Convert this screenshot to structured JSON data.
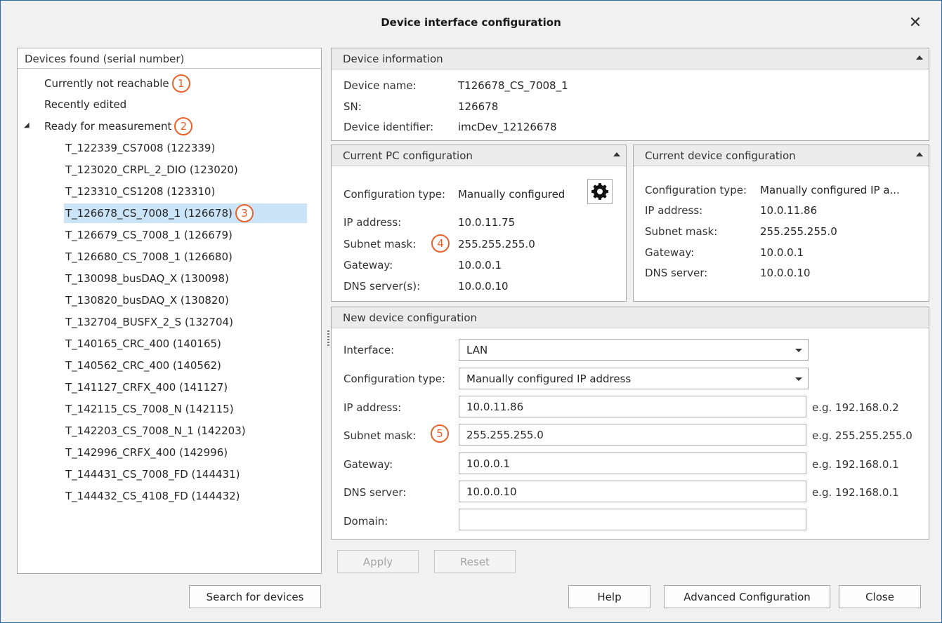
{
  "window": {
    "title": "Device interface configuration",
    "close_glyph": "✕"
  },
  "tree": {
    "header": "Devices found (serial number)",
    "categories": {
      "not_reachable": "Currently not reachable",
      "recently_edited": "Recently edited",
      "ready": "Ready for measurement"
    },
    "expander_glyph": "◢",
    "devices": [
      "T_122339_CS7008 (122339)",
      "T_123020_CRPL_2_DIO (123020)",
      "T_123310_CS1208 (123310)",
      "T_126678_CS_7008_1 (126678)",
      "T_126679_CS_7008_1 (126679)",
      "T_126680_CS_7008_1 (126680)",
      "T_130098_busDAQ_X (130098)",
      "T_130820_busDAQ_X (130820)",
      "T_132704_BUSFX_2_S (132704)",
      "T_140165_CRC_400 (140165)",
      "T_140562_CRC_400 (140562)",
      "T_141127_CRFX_400 (141127)",
      "T_142115_CS_7008_N (142115)",
      "T_142203_CS_7008_N_1 (142203)",
      "T_142996_CRFX_400 (142996)",
      "T_144431_CS_7008_FD (144431)",
      "T_144432_CS_4108_FD (144432)"
    ],
    "selected_index": 3
  },
  "badges": [
    "1",
    "2",
    "3",
    "4",
    "5"
  ],
  "device_info": {
    "header": "Device information",
    "name_label": "Device name:",
    "name_value": "T126678_CS_7008_1",
    "sn_label": "SN:",
    "sn_value": "126678",
    "id_label": "Device identifier:",
    "id_value": "imcDev_12126678"
  },
  "pc_config": {
    "header": "Current PC configuration",
    "type_label": "Configuration type:",
    "type_value": "Manually configured",
    "ip_label": "IP address:",
    "ip_value": "10.0.11.75",
    "mask_label": "Subnet mask:",
    "mask_value": "255.255.255.0",
    "gw_label": "Gateway:",
    "gw_value": "10.0.0.1",
    "dns_label": "DNS server(s):",
    "dns_value": "10.0.0.10"
  },
  "device_config": {
    "header": "Current device configuration",
    "type_label": "Configuration type:",
    "type_value": "Manually configured IP a...",
    "ip_label": "IP address:",
    "ip_value": "10.0.11.86",
    "mask_label": "Subnet mask:",
    "mask_value": "255.255.255.0",
    "gw_label": "Gateway:",
    "gw_value": "10.0.0.1",
    "dns_label": "DNS server:",
    "dns_value": "10.0.0.10"
  },
  "new_config": {
    "header": "New device configuration",
    "interface_label": "Interface:",
    "interface_value": "LAN",
    "type_label": "Configuration type:",
    "type_value": "Manually configured IP address",
    "ip_label": "IP address:",
    "ip_value": "10.0.11.86",
    "ip_hint": "e.g. 192.168.0.2",
    "mask_label": "Subnet mask:",
    "mask_value": "255.255.255.0",
    "mask_hint": "e.g. 255.255.255.0",
    "gw_label": "Gateway:",
    "gw_value": "10.0.0.1",
    "gw_hint": "e.g. 192.168.0.1",
    "dns_label": "DNS server:",
    "dns_value": "10.0.0.10",
    "dns_hint": "e.g. 192.168.0.1",
    "domain_label": "Domain:",
    "domain_value": ""
  },
  "buttons": {
    "apply": "Apply",
    "reset": "Reset",
    "search": "Search for devices",
    "help": "Help",
    "advanced": "Advanced Configuration",
    "close": "Close"
  },
  "colors": {
    "accent_badge": "#e8622a",
    "selection": "#cce4f7",
    "window_border": "#2c6ea9"
  }
}
